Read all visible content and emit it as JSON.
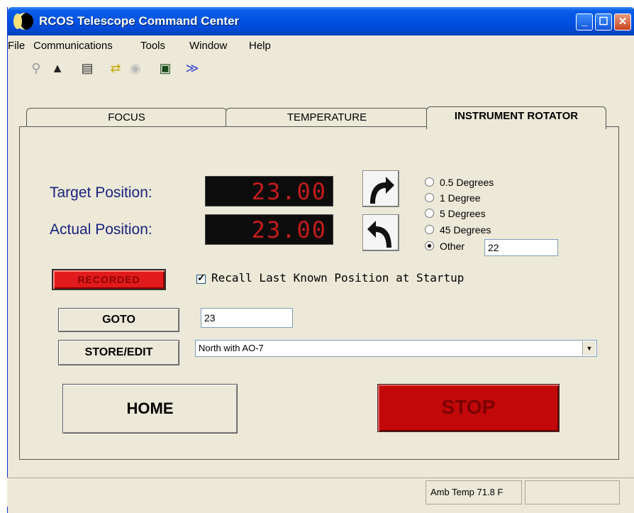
{
  "window": {
    "title": "RCOS Telescope Command Center"
  },
  "menu": [
    {
      "label": "File"
    },
    {
      "label": "Communications"
    },
    {
      "label": "Tools"
    },
    {
      "label": "Window"
    },
    {
      "label": "Help"
    }
  ],
  "toolbar": {
    "icons": [
      "connect-icon",
      "telescope-icon",
      "properties-icon",
      "folder-icon",
      "disabled-dial-icon",
      "monitor-icon",
      "chevron-down-icon"
    ]
  },
  "tabs": [
    {
      "label": "FOCUS"
    },
    {
      "label": "TEMPERATURE"
    },
    {
      "label": "INSTRUMENT ROTATOR",
      "active": true
    }
  ],
  "rotator": {
    "target_label": "Target Position:",
    "actual_label": "Actual Position:",
    "target_value": "23.00",
    "actual_value": "23.00",
    "step_options": [
      {
        "label": "0.5 Degrees",
        "checked": false
      },
      {
        "label": "1 Degree",
        "checked": false
      },
      {
        "label": "5 Degrees",
        "checked": false
      },
      {
        "label": "45 Degrees",
        "checked": false
      },
      {
        "label": "Other",
        "checked": true
      }
    ],
    "other_value": "22",
    "recorded_label": "RECORDED",
    "recall_label": "Recall Last Known Position at Startup",
    "recall_checked": true,
    "goto_label": "GOTO",
    "goto_value": "23",
    "store_label": "STORE/EDIT",
    "store_selected": "North with AO-7",
    "home_label": "HOME",
    "stop_label": "STOP"
  },
  "status": {
    "amb_temp": "Amb Temp 71.8 F"
  },
  "colors": {
    "led_text": "#c41c1c",
    "stop_bg": "#c20808",
    "recorded_bg": "#e11b1b",
    "title_blue": "#0054e3"
  }
}
